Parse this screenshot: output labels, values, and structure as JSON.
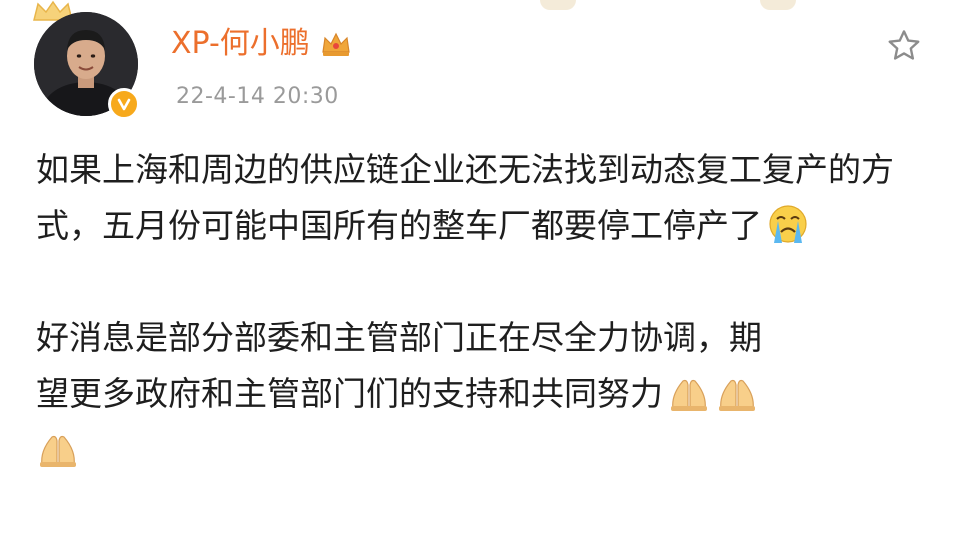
{
  "post": {
    "author": "XP-何小鹏",
    "timestamp": "22-4-14 20:30",
    "paragraph1": "如果上海和周边的供应链企业还无法找到动态复工复产的方式，五月份可能中国所有的整车厂都要停工停产了",
    "paragraph2_line1": "好消息是部分部委和主管部门正在尽全力协调，期",
    "paragraph2_line2": "望更多政府和主管部门们的支持和共同努力"
  },
  "icons": {
    "avatar": "avatar-photo",
    "verified": "verified-badge-icon",
    "vip": "crown-vip-icon",
    "favorite": "star-icon",
    "crying": "crying-face-emoji",
    "praying": "folded-hands-emoji"
  },
  "colors": {
    "username": "#ec6f2c",
    "timestamp": "#9a9a9a",
    "verified": "#f7a91c",
    "text": "#1e1e1e"
  }
}
